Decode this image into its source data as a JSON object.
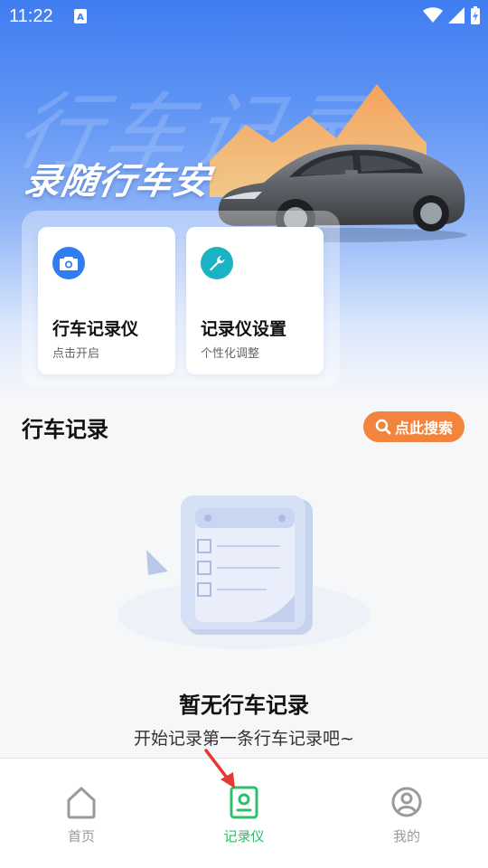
{
  "status_bar": {
    "time": "11:22",
    "icons": [
      "notification-a-icon",
      "wifi-icon",
      "signal-icon",
      "battery-charging-icon"
    ]
  },
  "hero": {
    "watermark_text": "行车记录",
    "slogan": "录随行车安"
  },
  "features": [
    {
      "title": "行车记录仪",
      "subtitle": "点击开启",
      "icon": "camera-icon",
      "color": "#2f7df0"
    },
    {
      "title": "记录仪设置",
      "subtitle": "个性化调整",
      "icon": "wrench-icon",
      "color": "#1bb3c4"
    }
  ],
  "records": {
    "section_title": "行车记录",
    "search_label": "点此搜索",
    "empty_title": "暂无行车记录",
    "empty_subtitle": "开始记录第一条行车记录吧~"
  },
  "tabs": [
    {
      "label": "首页",
      "icon": "home-icon",
      "active": false
    },
    {
      "label": "记录仪",
      "icon": "recorder-icon",
      "active": true
    },
    {
      "label": "我的",
      "icon": "profile-icon",
      "active": false
    }
  ],
  "colors": {
    "primary_blue": "#3f7df2",
    "accent_orange": "#f2843d",
    "active_green": "#2fbf6a",
    "inactive_gray": "#9a9a9a"
  }
}
